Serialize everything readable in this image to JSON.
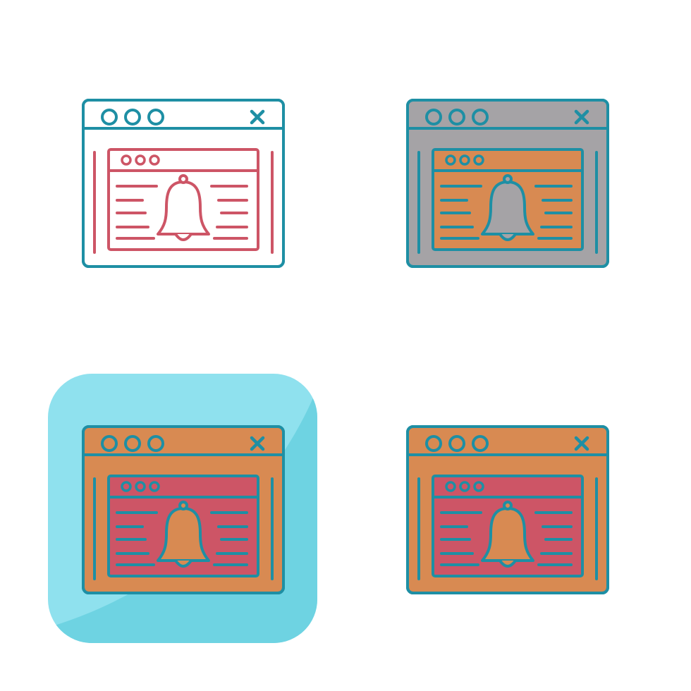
{
  "colors": {
    "stroke": "#1e8fa4",
    "line_red": "#cd5566",
    "gray": "#a5a3a6",
    "orange": "#d88a52",
    "red": "#cd5566",
    "white": "#ffffff",
    "tile_light": "#8fe1ee",
    "tile_dark": "#6ed3e2"
  },
  "icons": [
    {
      "id": "line",
      "name": "browser-notification-icon-line",
      "style": "outline",
      "header_fill": "#ffffff",
      "body_fill": "#ffffff",
      "inner_header_fill": "#ffffff",
      "inner_body_fill": "#ffffff",
      "bell_fill": "#ffffff",
      "outer_stroke": "#1e8fa4",
      "inner_stroke": "#cd5566",
      "side_line_stroke": "#cd5566"
    },
    {
      "id": "glyph-gray",
      "name": "browser-notification-icon-gray",
      "style": "filled-gray",
      "header_fill": "#a5a3a6",
      "body_fill": "#a5a3a6",
      "inner_header_fill": "#d88a52",
      "inner_body_fill": "#d88a52",
      "bell_fill": "#a5a3a6",
      "outer_stroke": "#1e8fa4",
      "inner_stroke": "#1e8fa4",
      "side_line_stroke": "#1e8fa4"
    },
    {
      "id": "tile",
      "name": "browser-notification-icon-tile",
      "style": "filled-on-tile",
      "header_fill": "#d88a52",
      "body_fill": "#d88a52",
      "inner_header_fill": "#cd5566",
      "inner_body_fill": "#cd5566",
      "bell_fill": "#d88a52",
      "outer_stroke": "#1e8fa4",
      "inner_stroke": "#1e8fa4",
      "side_line_stroke": "#1e8fa4"
    },
    {
      "id": "flat",
      "name": "browser-notification-icon-flat",
      "style": "filled",
      "header_fill": "#d88a52",
      "body_fill": "#d88a52",
      "inner_header_fill": "#cd5566",
      "inner_body_fill": "#cd5566",
      "bell_fill": "#d88a52",
      "outer_stroke": "#1e8fa4",
      "inner_stroke": "#1e8fa4",
      "side_line_stroke": "#1e8fa4"
    }
  ]
}
